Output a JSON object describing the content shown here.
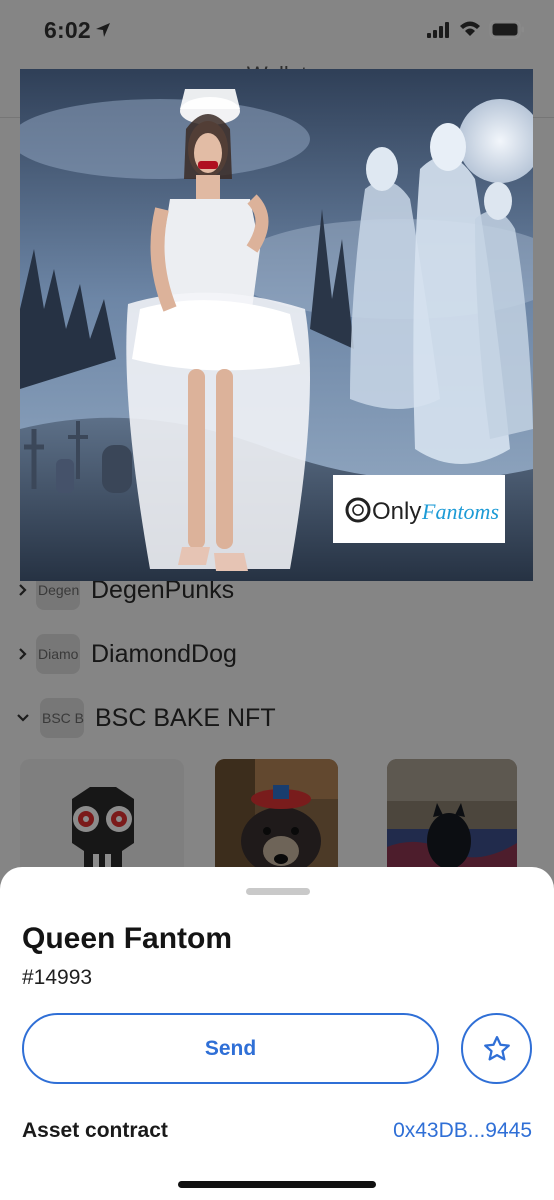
{
  "status_bar": {
    "time": "6:02"
  },
  "wallet": {
    "title": "Wallet",
    "collections": [
      {
        "thumb_text": "Degen",
        "name": "DegenPunks",
        "expanded": false
      },
      {
        "thumb_text": "Diamo",
        "name": "DiamondDog",
        "expanded": false
      },
      {
        "thumb_text": "BSC B",
        "name": "BSC BAKE NFT",
        "expanded": true
      }
    ]
  },
  "artwork": {
    "watermark_prefix": "Only",
    "watermark_suffix": "Fantoms"
  },
  "nft_detail": {
    "name": "Queen Fantom",
    "token_id": "#14993",
    "send_label": "Send",
    "asset_contract_label": "Asset contract",
    "asset_contract_value": "0x43DB...9445"
  },
  "colors": {
    "accent": "#2f6fd6",
    "sheet": "#ffffff"
  }
}
